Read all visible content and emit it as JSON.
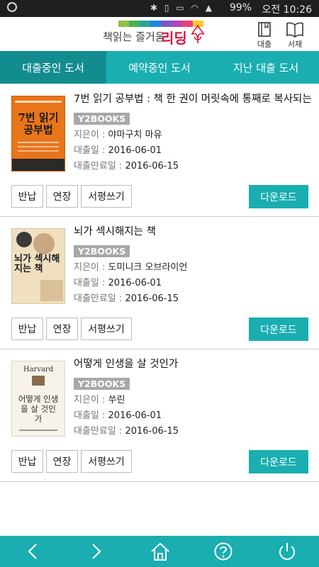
{
  "statusbar": {
    "battery": "99%",
    "time": "오전 10:26",
    "icons": [
      "bluetooth-icon",
      "vibrate-icon",
      "hd-icon",
      "wifi-icon",
      "signal-icon",
      "battery-icon"
    ]
  },
  "header": {
    "logo_text": "책읽는 즐거움",
    "logo_brand": "리딩",
    "logo_bar_colors": [
      "#8bc34a",
      "#4caf50",
      "#26a69a",
      "#1e88e5",
      "#7e57c2",
      "#ab47bc",
      "#ec407a",
      "#ffca28"
    ],
    "loan_label": "대출",
    "shelf_label": "서재"
  },
  "tabs": [
    {
      "label": "대출중인 도서",
      "active": true
    },
    {
      "label": "예약중인 도서",
      "active": false
    },
    {
      "label": "지난 대출 도서",
      "active": false
    }
  ],
  "labels": {
    "author": "지은이 : ",
    "loan_date": "대출일 : ",
    "due_date": "대출만료일 : ",
    "return": "반납",
    "extend": "연장",
    "review": "서평쓰기",
    "download": "다운로드"
  },
  "books": [
    {
      "title": "7번 읽기 공부법 : 책 한 권이 머릿속에 통째로 복사되는",
      "publisher": "Y2BOOKS",
      "author": "야마구치 마유",
      "loan_date": "2016-06-01",
      "due_date": "2016-06-15",
      "cover_text": "7번 읽기 공부법",
      "cover_color": "#e8751a"
    },
    {
      "title": "뇌가 섹시해지는 책",
      "publisher": "Y2BOOKS",
      "author": "도미니크 오브라이언",
      "loan_date": "2016-06-01",
      "due_date": "2016-06-15",
      "cover_text": "뇌가 섹시해지는 책",
      "cover_color": "#f0e0c0"
    },
    {
      "title": "어떻게 인생을 살 것인가",
      "publisher": "Y2BOOKS",
      "author": "쑤린",
      "loan_date": "2016-06-01",
      "due_date": "2016-06-15",
      "cover_text": "어떻게 인생을 살 것인가",
      "cover_top_text": "Harvard",
      "cover_color": "#f7f3ea"
    }
  ],
  "bottomnav": {
    "icons": [
      "back-arrow-icon",
      "forward-arrow-icon",
      "home-icon",
      "help-icon",
      "power-icon"
    ]
  },
  "colors": {
    "accent": "#1aaeb1",
    "tab_active": "#138c8f",
    "brand_red": "#d9143a",
    "publisher_badge": "#a8a8a8"
  }
}
